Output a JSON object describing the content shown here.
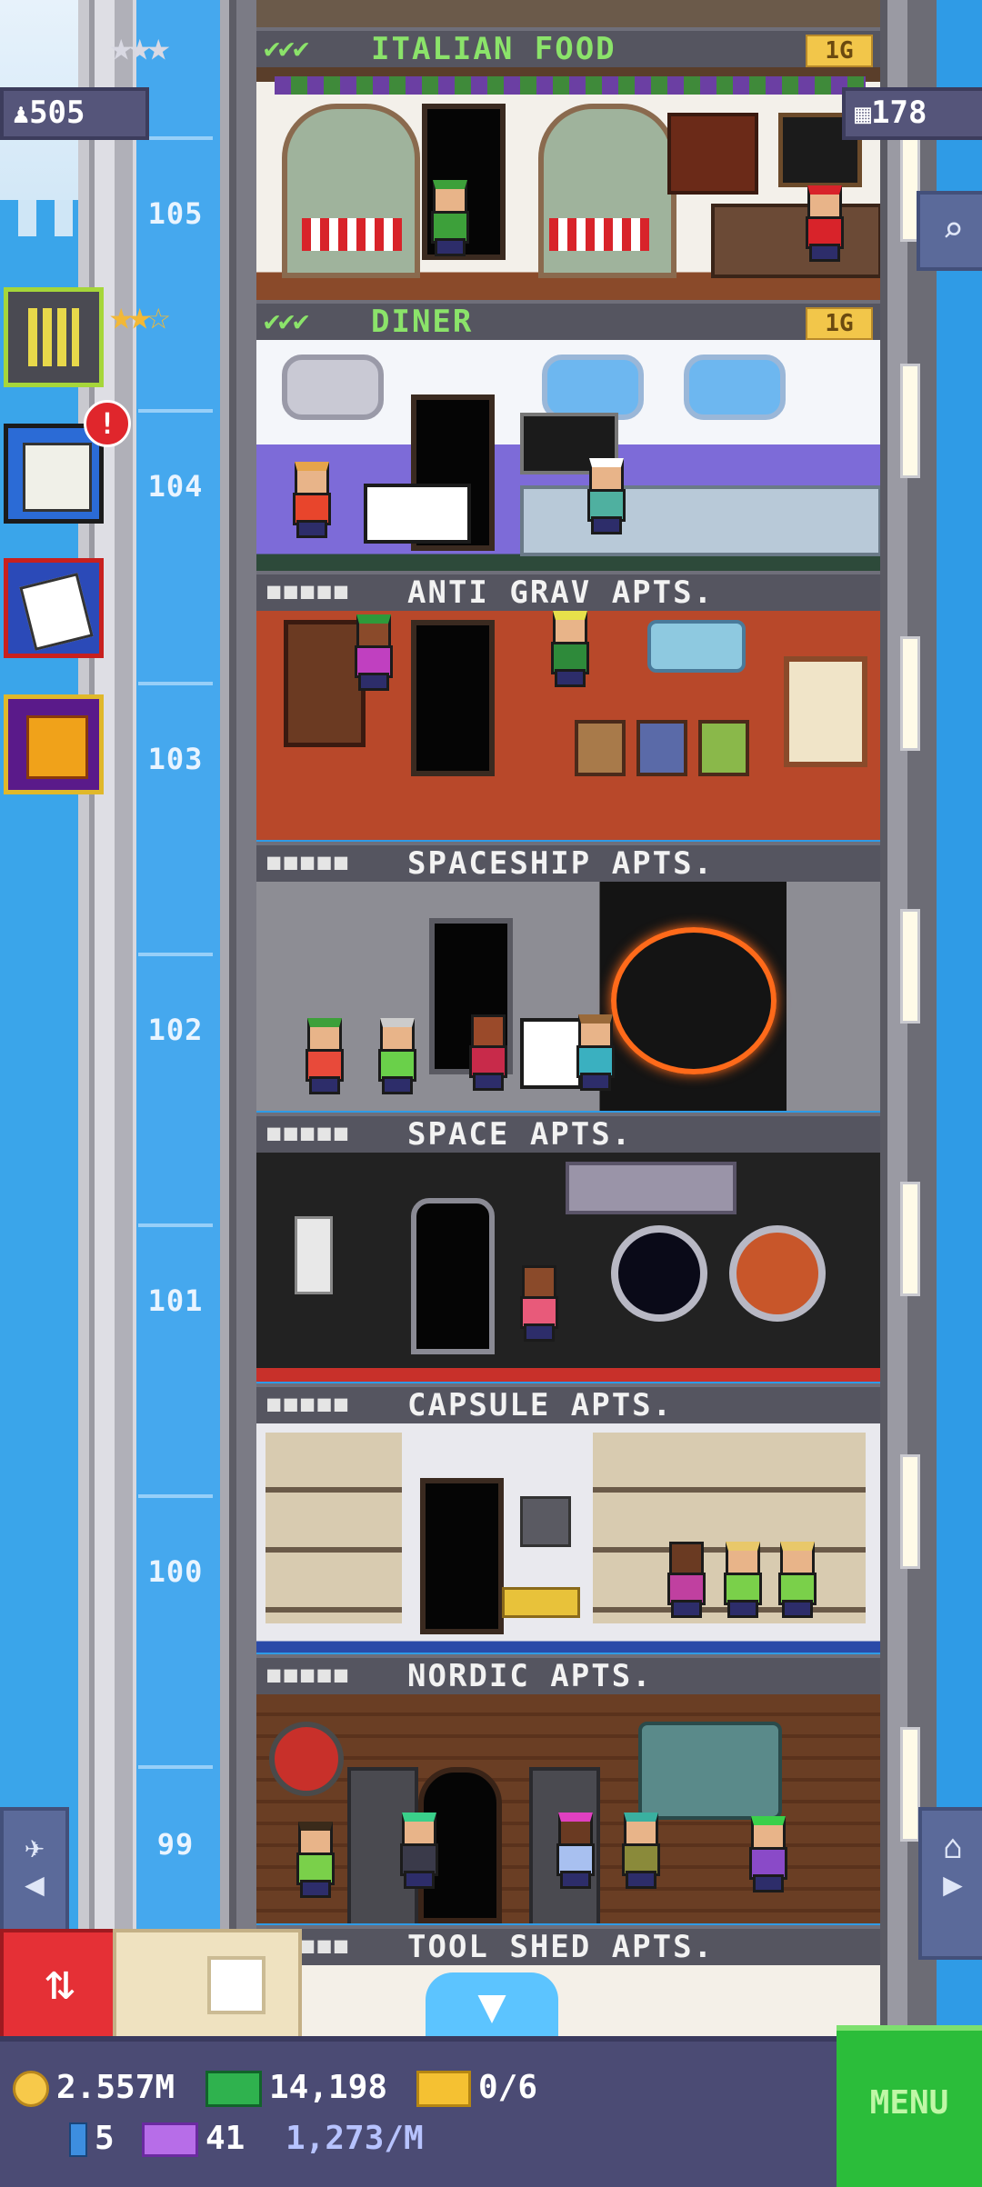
{
  "hud": {
    "population": "505",
    "floor_count": "178"
  },
  "business_floors": [
    {
      "name": "ITALIAN FOOD",
      "checks": "✔✔✔",
      "level": "1G",
      "stars": "★★★"
    },
    {
      "name": "DINER",
      "checks": "✔✔✔",
      "level": "1G",
      "stars": "★★☆"
    }
  ],
  "residential_floors": [
    {
      "number": "104",
      "name": "ANTI GRAV APTS."
    },
    {
      "number": "103",
      "name": "SPACESHIP APTS."
    },
    {
      "number": "102",
      "name": "SPACE APTS."
    },
    {
      "number": "101",
      "name": "CAPSULE APTS."
    },
    {
      "number": "100",
      "name": "NORDIC APTS."
    },
    {
      "number": "99",
      "name": "TOOL SHED APTS."
    }
  ],
  "shaft_numbers": [
    "105",
    "104",
    "103",
    "102",
    "101",
    "100",
    "99"
  ],
  "side_buttons": {
    "missions_badge": "!"
  },
  "icons": {
    "search": "magnifier",
    "nav_left": "elevator-person-left",
    "nav_right": "home-right",
    "scroll_down": "▼",
    "elevator_updown": "⇅"
  },
  "bottom_bar": {
    "coins": "2.557M",
    "bux": "14,198",
    "tickets": "0/6",
    "tower_bux": "5",
    "golden": "41",
    "rate": "1,273/M",
    "menu_label": "MENU"
  },
  "colors": {
    "biz_text": "#8be36a",
    "menu_green": "#2bbd3a",
    "alert_red": "#e0262c",
    "sky": "#2f9be6"
  }
}
